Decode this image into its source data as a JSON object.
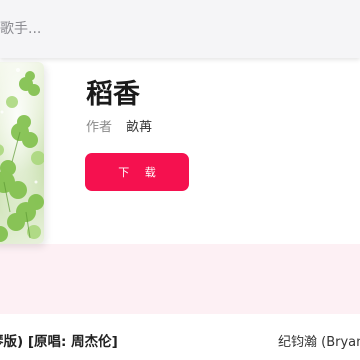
{
  "search": {
    "placeholder": "歌手..."
  },
  "song": {
    "title": "稻香",
    "author_label": "作者",
    "author_name": "畝苒",
    "download_label": "下 载"
  },
  "list": {
    "row": {
      "title": "琴版) [原唱: 周杰伦]",
      "artist": "纪钧瀚 (Bryan"
    }
  },
  "colors": {
    "accent": "#f5114f",
    "band": "#fdf0f4",
    "search_bg": "#f5f5f7"
  }
}
